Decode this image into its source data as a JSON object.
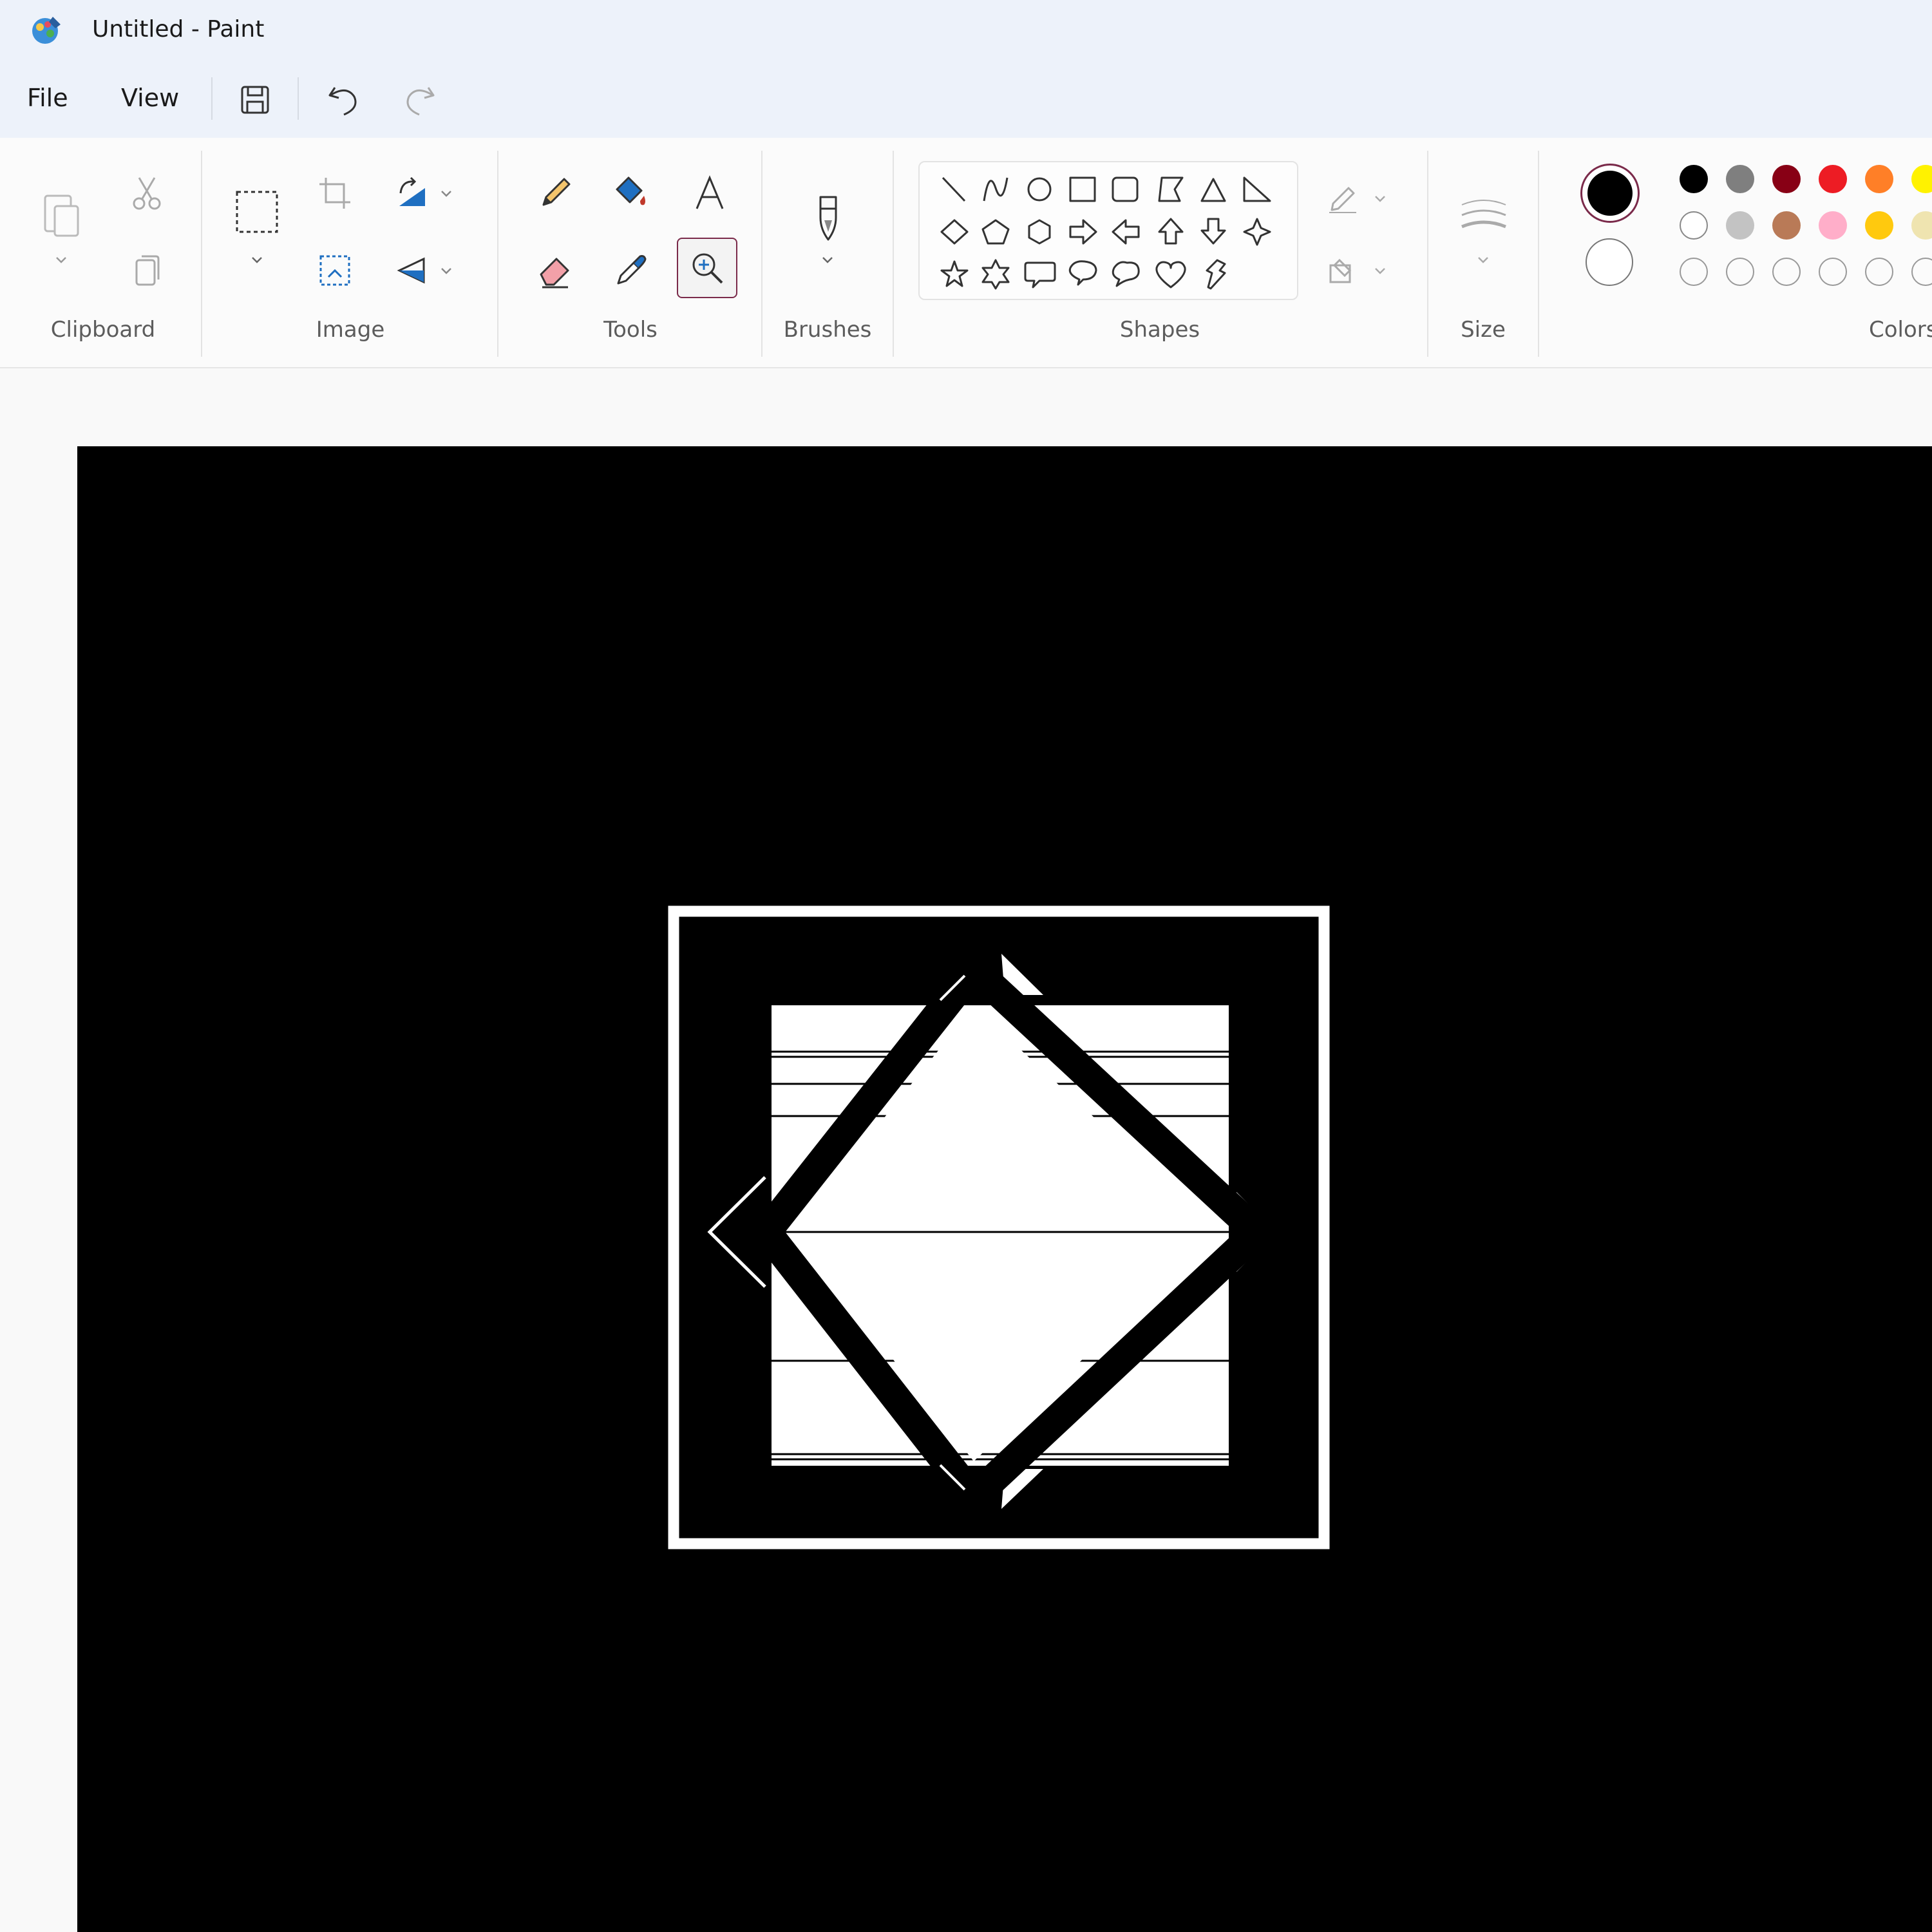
{
  "window": {
    "title": "Untitled - Paint"
  },
  "menu": {
    "file": "File",
    "view": "View"
  },
  "ribbon": {
    "groups": {
      "clipboard": "Clipboard",
      "image": "Image",
      "tools": "Tools",
      "brushes": "Brushes",
      "shapes": "Shapes",
      "size": "Size",
      "colors": "Colors"
    },
    "active_tool": "magnifier"
  },
  "colors": {
    "primary": "#000000",
    "secondary": "#ffffff",
    "palette_row1": [
      "#000000",
      "#7f7f7f",
      "#880015",
      "#ed1c24",
      "#ff7f27",
      "#fff200"
    ],
    "palette_row2": [
      "#ffffff",
      "#c3c3c3",
      "#b97a57",
      "#ffaec9",
      "#ffc90e",
      "#efe4b0"
    ]
  }
}
